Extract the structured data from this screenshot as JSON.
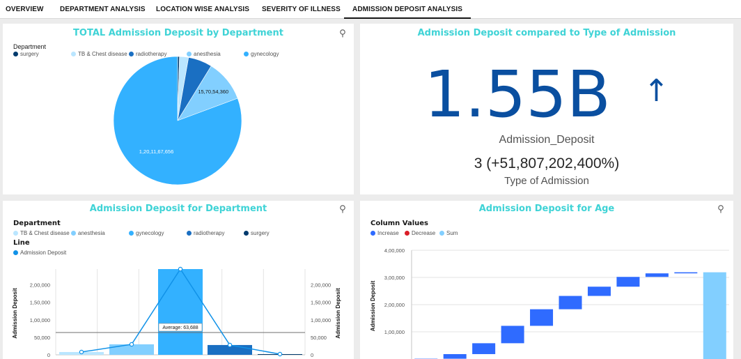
{
  "tabs": [
    {
      "label": "OVERVIEW",
      "active": false
    },
    {
      "label": "DEPARTMENT ANALYSIS",
      "active": false
    },
    {
      "label": "LOCATION WISE ANALYSIS",
      "active": false
    },
    {
      "label": "SEVERITY OF ILLNESS",
      "active": false
    },
    {
      "label": "ADMISSION DEPOSIT ANALYSIS",
      "active": true
    }
  ],
  "colors": {
    "title": "#3fd3d6",
    "surgery": "#003a6d",
    "tb_chest": "#bae6ff",
    "radiotherapy": "#1a6fc2",
    "anesthesia": "#82cfff",
    "gynecology": "#33b1ff",
    "kpi": "#0a4fa0",
    "increase": "#2f6bff",
    "decrease": "#da1e28",
    "sum": "#82cfff"
  },
  "pie_card": {
    "title": "TOTAL  Admission  Deposit by Department",
    "legend_title": "Department",
    "legend": [
      {
        "label": "surgery",
        "color": "#003a6d"
      },
      {
        "label": "TB & Chest disease",
        "color": "#bae6ff"
      },
      {
        "label": "radiotherapy",
        "color": "#1a6fc2"
      },
      {
        "label": "anesthesia",
        "color": "#82cfff"
      },
      {
        "label": "gynecology",
        "color": "#33b1ff"
      }
    ]
  },
  "kpi_card": {
    "title": "Admission Deposit compared to Type of Admission",
    "value": "1.55B",
    "arrow": "↑",
    "value_label": "Admission_Deposit",
    "compare_value": "3 (+51,807,202,400%)",
    "compare_label": "Type of Admission"
  },
  "dept_card": {
    "title": "Admission Deposit for Department",
    "legend_heading": "Department",
    "legend": [
      {
        "label": "TB & Chest disease",
        "color": "#bae6ff"
      },
      {
        "label": "anesthesia",
        "color": "#82cfff"
      },
      {
        "label": "gynecology",
        "color": "#33b1ff"
      },
      {
        "label": "radiotherapy",
        "color": "#1a6fc2"
      },
      {
        "label": "surgery",
        "color": "#003a6d"
      }
    ],
    "line_heading": "Line",
    "line_legend": {
      "label": "Admission Deposit",
      "color": "#1192e8"
    }
  },
  "age_card": {
    "title": "Admission Deposit for Age",
    "legend_heading": "Column Values",
    "legend": [
      {
        "label": "Increase",
        "color": "#2f6bff"
      },
      {
        "label": "Decrease",
        "color": "#da1e28"
      },
      {
        "label": "Sum",
        "color": "#82cfff"
      }
    ]
  },
  "chart_data": [
    {
      "type": "pie",
      "title": "TOTAL  Admission  Deposit by Department",
      "legend_title": "Department",
      "categories": [
        "surgery",
        "TB & Chest disease",
        "radiotherapy",
        "anesthesia",
        "gynecology"
      ],
      "values": [
        700000,
        3400000,
        9000000,
        15705436,
        120116765
      ],
      "data_labels": [
        {
          "category": "anesthesia",
          "text": "15,70,54,360"
        },
        {
          "category": "gynecology",
          "text": "1,20,11,67,656"
        }
      ],
      "colors": [
        "#003a6d",
        "#bae6ff",
        "#1a6fc2",
        "#82cfff",
        "#33b1ff"
      ]
    },
    {
      "type": "bar",
      "title": "Admission Deposit for Department",
      "categories": [
        "TB & Chest disease",
        "anesthesia",
        "gynecology",
        "radiotherapy",
        "surgery"
      ],
      "series": [
        {
          "name": "Admission Deposit",
          "values": [
            8000,
            30000,
            245000,
            28000,
            2000
          ]
        }
      ],
      "line_series": {
        "name": "Admission Deposit",
        "values": [
          8000,
          30000,
          245000,
          28000,
          2000
        ]
      },
      "average": {
        "label": "Average: 63,688",
        "value": 63688
      },
      "ylabel": "Admission Deposit",
      "y2label": "Admission Deposit",
      "ylim": [
        0,
        245000
      ],
      "yticks": [
        0,
        50000,
        100000,
        150000,
        200000
      ],
      "ytick_labels": [
        "0",
        "50,000",
        "1,00,000",
        "1,50,000",
        "2,00,000"
      ]
    },
    {
      "type": "bar",
      "subtype": "waterfall",
      "title": "Admission Deposit for Age",
      "legend_title": "Column Values",
      "ylabel": "Admission Deposit",
      "ylim": [
        0,
        400000
      ],
      "yticks": [
        100000,
        200000,
        300000,
        400000
      ],
      "ytick_labels": [
        "1,00,000",
        "2,00,000",
        "3,00,000",
        "4,00,000"
      ],
      "steps": [
        {
          "kind": "increase",
          "from": 0,
          "to": 1000
        },
        {
          "kind": "increase",
          "from": 1000,
          "to": 18000
        },
        {
          "kind": "increase",
          "from": 18000,
          "to": 58000
        },
        {
          "kind": "increase",
          "from": 58000,
          "to": 122000
        },
        {
          "kind": "increase",
          "from": 122000,
          "to": 183000
        },
        {
          "kind": "increase",
          "from": 183000,
          "to": 232000
        },
        {
          "kind": "increase",
          "from": 232000,
          "to": 266000
        },
        {
          "kind": "increase",
          "from": 266000,
          "to": 302000
        },
        {
          "kind": "increase",
          "from": 302000,
          "to": 315000
        },
        {
          "kind": "increase",
          "from": 315000,
          "to": 319000
        },
        {
          "kind": "sum",
          "from": 0,
          "to": 319000
        }
      ]
    }
  ]
}
